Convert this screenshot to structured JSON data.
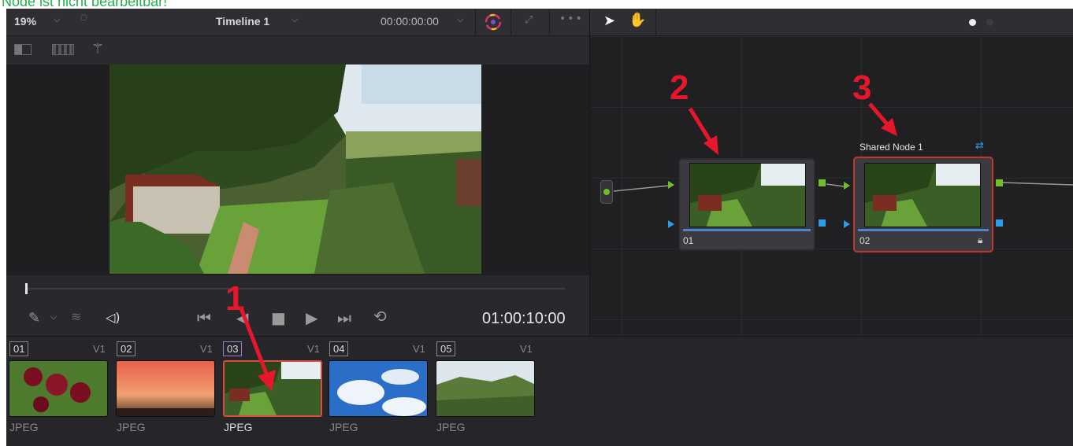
{
  "caption": "Node ist nicht bearbeitbar!",
  "viewer": {
    "zoom": "19%",
    "timeline_name": "Timeline 1",
    "timecode": "00:00:00:00",
    "playhead_timecode": "01:00:10:00",
    "playhead_progress": 0.0
  },
  "nodes": [
    {
      "label": "01",
      "title": "",
      "locked": false
    },
    {
      "label": "02",
      "title": "Shared Node 1",
      "locked": true
    }
  ],
  "clips": [
    {
      "num": "01",
      "track": "V1",
      "type": "JPEG",
      "active": false
    },
    {
      "num": "02",
      "track": "V1",
      "type": "JPEG",
      "active": false
    },
    {
      "num": "03",
      "track": "V1",
      "type": "JPEG",
      "active": true
    },
    {
      "num": "04",
      "track": "V1",
      "type": "JPEG",
      "active": false
    },
    {
      "num": "05",
      "track": "V1",
      "type": "",
      "active": false
    }
  ],
  "annotations": [
    "1",
    "2",
    "3"
  ],
  "colors": {
    "annotation_red": "#e8162a",
    "caption_green": "#22b14c",
    "selected_border": "#c0392b",
    "port_green": "#6dbf2a",
    "port_blue": "#2b9de8"
  }
}
